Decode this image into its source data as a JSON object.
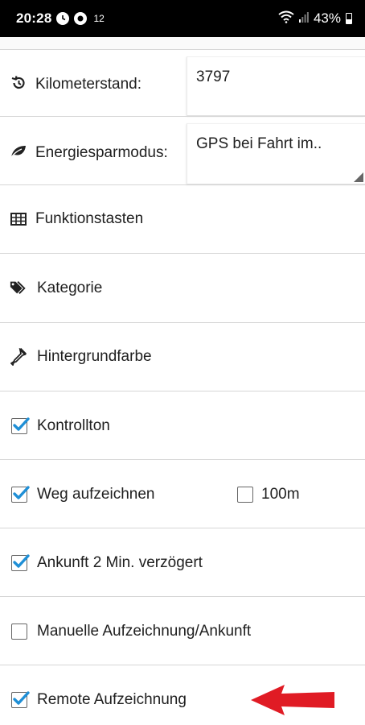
{
  "status_bar": {
    "time": "20:28",
    "notification_count": "12",
    "battery_percent": "43%"
  },
  "settings": {
    "odometer": {
      "label": "Kilometerstand:",
      "value": "3797"
    },
    "power_saving": {
      "label": "Energiesparmodus:",
      "value": "GPS bei Fahrt im.."
    },
    "function_keys": {
      "label": "Funktionstasten"
    },
    "category": {
      "label": "Kategorie"
    },
    "background_color": {
      "label": "Hintergrundfarbe"
    },
    "control_tone": {
      "label": "Kontrollton",
      "checked": true
    },
    "record_route": {
      "label": "Weg aufzeichnen",
      "checked": true,
      "distance_label": "100m",
      "distance_checked": false
    },
    "arrival_delay": {
      "label": "Ankunft 2 Min. verzögert",
      "checked": true
    },
    "manual_recording": {
      "label": "Manuelle Aufzeichnung/Ankunft",
      "checked": false
    },
    "remote_recording": {
      "label": "Remote Aufzeichnung",
      "checked": true
    }
  },
  "colors": {
    "checkbox_check": "#1f8fd6",
    "annotation_arrow": "#e01b24"
  }
}
